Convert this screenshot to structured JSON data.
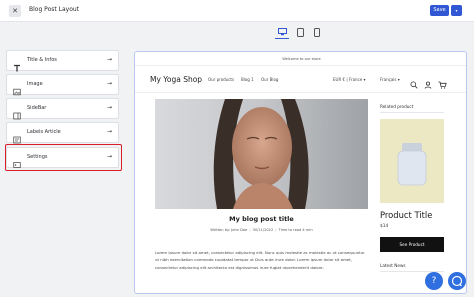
{
  "topbar": {
    "close_icon": "✕",
    "title": "Blog Post Layout",
    "save_label": "Save",
    "more_icon": "▾"
  },
  "device_toggle": [
    "desktop-icon",
    "tablet-icon",
    "mobile-icon"
  ],
  "sidebar": {
    "items": [
      {
        "label": "Title & Infos",
        "icon": "text-icon"
      },
      {
        "label": "Image",
        "icon": "image-icon"
      },
      {
        "label": "SideBar",
        "icon": "sidebar-icon"
      },
      {
        "label": "Labels Article",
        "icon": "label-icon"
      },
      {
        "label": "Settings",
        "icon": "settings-icon"
      }
    ],
    "arrow": "→"
  },
  "preview": {
    "announcement": "Welcome to our store",
    "logo": "My Yoga Shop",
    "nav": [
      "Our products",
      "Blog 1",
      "Our Blog"
    ],
    "currency": "EUR € | France ▾",
    "language": "Français ▾",
    "post": {
      "title": "My blog post title",
      "author": "Written by: John Doe",
      "date": "30/11/2022",
      "read_time": "Time to read 4 min",
      "body": "Lorem ipsum dolor sit amet, consectetur adipiscing elit. Nunc quis molestie ac molestie ac ut consequuntur ut nibh exercitation commodo cupidatat tempor ut Duis aute irure dolor. Lorem ipsum dolor sit amet, consectetur adipiscing elit architecto est dignissimos irure fugiat reprehenderit dolore."
    },
    "sidebar": {
      "related_heading": "Related product",
      "product_title": "Product Title",
      "price": "$14",
      "button": "See Product",
      "latest_heading": "Latest News"
    }
  },
  "fab": {
    "help": "?",
    "chat": "chat-icon"
  },
  "colors": {
    "accent": "#3157d4",
    "highlight": "#d91e2a",
    "product_bg": "#ece8c4"
  }
}
